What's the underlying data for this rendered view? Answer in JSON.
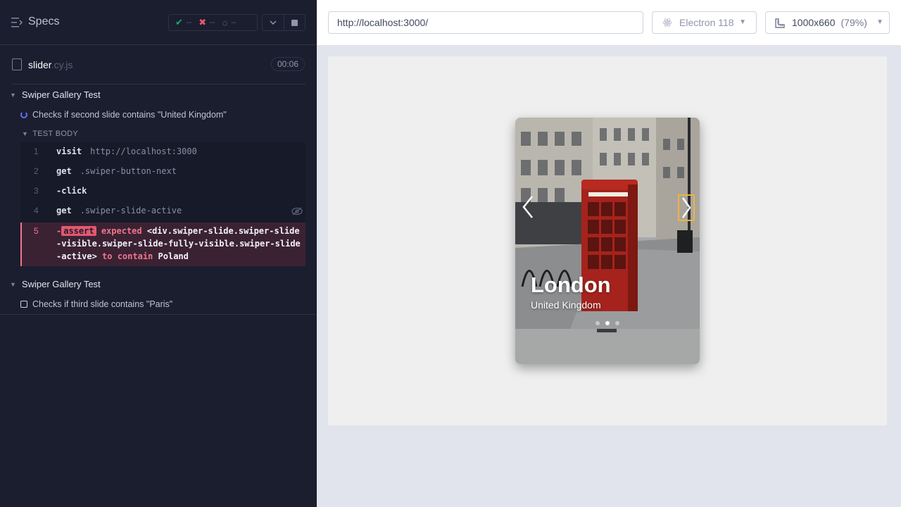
{
  "sidebar": {
    "title": "Specs",
    "stats": {
      "passed": "--",
      "failed": "--",
      "pending": "--"
    },
    "file": {
      "name": "slider",
      "ext": ".cy.js",
      "duration": "00:06"
    },
    "suites": [
      {
        "title": "Swiper Gallery Test",
        "test": "Checks if second slide contains \"United Kingdom\"",
        "body_label": "TEST BODY",
        "commands": [
          {
            "num": "1",
            "name": "visit",
            "msg": "http://localhost:3000"
          },
          {
            "num": "2",
            "name": "get",
            "msg": ".swiper-button-next"
          },
          {
            "num": "3",
            "name": "-click",
            "msg": ""
          },
          {
            "num": "4",
            "name": "get",
            "msg": ".swiper-slide-active"
          }
        ],
        "error": {
          "num": "5",
          "prefix": "-",
          "badge": "assert",
          "expected": "expected",
          "subject": "<div.swiper-slide.swiper-slide-visible.swiper-slide-fully-visible.swiper-slide-active>",
          "to_contain": "to contain",
          "value": "Poland"
        }
      },
      {
        "title": "Swiper Gallery Test",
        "test": "Checks if third slide contains \"Paris\""
      }
    ]
  },
  "topbar": {
    "url": "http://localhost:3000/",
    "browser": "Electron 118",
    "viewport": "1000x660",
    "scale": "(79%)"
  },
  "slider": {
    "title": "London",
    "subtitle": "United Kingdom",
    "active_dot": 1,
    "dot_count": 3
  }
}
